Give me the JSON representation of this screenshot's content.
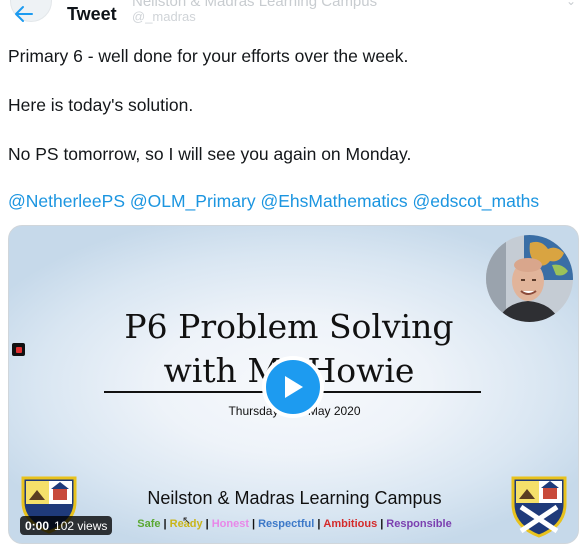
{
  "header": {
    "title": "Tweet",
    "ghost_name": "Neilston & Madras Learning Campus",
    "ghost_handle": "@_madras"
  },
  "tweet": {
    "lines": [
      "Primary 6 - well done for your efforts over the week.",
      "Here is today's solution.",
      "No PS tomorrow, so I will see you again on Monday."
    ],
    "mentions": [
      "@NetherleePS",
      "@OLM_Primary",
      "@EhsMathematics",
      "@edscot_maths"
    ]
  },
  "video": {
    "slide_title_line1": "P6 Problem Solving",
    "slide_title_line2": "with Mr Howie",
    "slide_date": "Thursday 21st May 2020",
    "campus_name": "Neilston & Madras Learning Campus",
    "values": [
      {
        "label": "Safe",
        "color": "#5aa832"
      },
      {
        "label": "Ready",
        "color": "#c9b51a"
      },
      {
        "label": "Honest",
        "color": "#e887e8"
      },
      {
        "label": "Respectful",
        "color": "#3c78c8"
      },
      {
        "label": "Ambitious",
        "color": "#d42a2a"
      },
      {
        "label": "Responsible",
        "color": "#7b3fb0"
      }
    ],
    "elapsed_time": "0:00",
    "view_count": "102 views"
  },
  "colors": {
    "link": "#1b95e0",
    "play_button": "#1d9bf0"
  },
  "icons": {
    "back": "arrow-left-icon",
    "play": "play-icon"
  }
}
